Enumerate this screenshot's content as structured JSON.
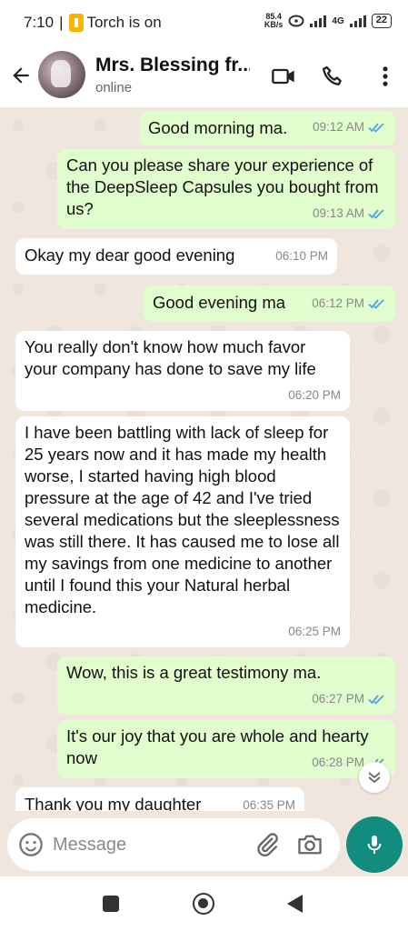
{
  "status_bar": {
    "time": "7:10",
    "notification": "Torch is on",
    "speed_value": "85.4",
    "speed_unit": "KB/s",
    "network": "4G",
    "battery": "22"
  },
  "header": {
    "contact_name": "Mrs. Blessing fr...",
    "contact_status": "online"
  },
  "messages": [
    {
      "dir": "out",
      "text": "Good morning ma.",
      "time": "09:12 AM",
      "read": true
    },
    {
      "dir": "out",
      "text": "Can you please share your experience of the DeepSleep Capsules you bought from us?",
      "time": "09:13 AM",
      "read": true
    },
    {
      "dir": "in",
      "text": "Okay my dear good evening",
      "time": "06:10 PM"
    },
    {
      "dir": "out",
      "text": "Good evening ma",
      "time": "06:12 PM",
      "read": true
    },
    {
      "dir": "in",
      "text": "You really don't know how much favor your company has done to save my life",
      "time": "06:20 PM"
    },
    {
      "dir": "in",
      "text": "I have been battling with lack of sleep for 25 years now and it has made my health worse, I started having high blood pressure at the age of 42 and I've tried several medications but the sleeplessness was still there. It has caused me to lose all my savings from one medicine to another until I found this your Natural herbal medicine.",
      "time": "06:25 PM"
    },
    {
      "dir": "out",
      "text": "Wow, this is a great testimony ma.",
      "time": "06:27 PM",
      "read": true
    },
    {
      "dir": "out",
      "text": "It's our joy that you are whole and hearty now",
      "time": "06:28 PM",
      "read": true
    },
    {
      "dir": "in",
      "text": "Thank you my daughter",
      "time": "06:35 PM"
    }
  ],
  "input": {
    "placeholder": "Message"
  },
  "colors": {
    "outgoing_bubble": "#e2fdcd",
    "incoming_bubble": "#ffffff",
    "chat_background": "#efe7de",
    "accent": "#128c7e",
    "read_ticks": "#4fa3e0"
  },
  "icons": [
    "back-arrow-icon",
    "video-call-icon",
    "phone-call-icon",
    "more-options-icon",
    "emoji-icon",
    "attach-icon",
    "camera-icon",
    "mic-icon",
    "scroll-down-icon"
  ]
}
